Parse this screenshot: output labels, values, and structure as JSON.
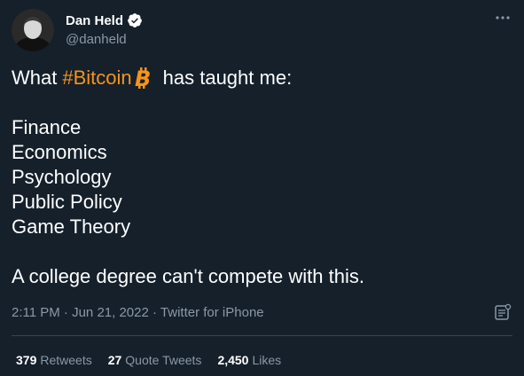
{
  "author": {
    "name": "Dan Held",
    "handle": "@danheld"
  },
  "tweet": {
    "lead": "What",
    "hashtag": "#Bitcoin",
    "after_icon": "has taught me:",
    "topics": [
      "Finance",
      "Economics",
      "Psychology",
      "Public Policy",
      "Game Theory"
    ],
    "closing": "A college degree can't compete with this.",
    "time": "2:11 PM",
    "date": "Jun 21, 2022",
    "source": "Twitter for iPhone",
    "separator": "·"
  },
  "stats": {
    "retweets_count": "379",
    "retweets_label": "Retweets",
    "quotes_count": "27",
    "quotes_label": "Quote Tweets",
    "likes_count": "2,450",
    "likes_label": "Likes"
  },
  "colors": {
    "background": "#15202b",
    "hashtag": "#f7931a",
    "secondary_text": "#8b98a5",
    "verified": "#ffffff",
    "divider": "#38444d"
  },
  "icons": [
    "verified-badge-icon",
    "more-options-icon",
    "bitcoin-emoji-icon",
    "analytics-icon"
  ]
}
